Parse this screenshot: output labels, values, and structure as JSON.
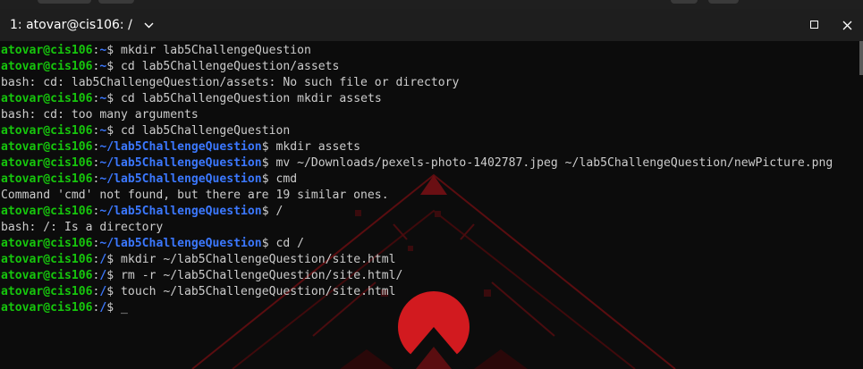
{
  "window": {
    "tab_title": "1: atovar@cis106: /",
    "icons": {
      "dropdown": "chevron-down-icon",
      "minimize": "minimize-icon",
      "maximize": "maximize-icon",
      "close": "close-icon"
    }
  },
  "colors": {
    "background": "#0c0c0c",
    "titlebar": "#1e1e1e",
    "user_host": "#16c60c",
    "path": "#3b78ff",
    "text": "#cccccc",
    "art_red": "#c0151b"
  },
  "terminal": {
    "lines": [
      {
        "user": "atovar@cis106",
        "sep": ":",
        "path": "~",
        "dollar": "$ ",
        "cmd": "mkdir lab5ChallengeQuestion"
      },
      {
        "user": "atovar@cis106",
        "sep": ":",
        "path": "~",
        "dollar": "$ ",
        "cmd": "cd lab5ChallengeQuestion/assets"
      },
      {
        "out": "bash: cd: lab5ChallengeQuestion/assets: No such file or directory"
      },
      {
        "user": "atovar@cis106",
        "sep": ":",
        "path": "~",
        "dollar": "$ ",
        "cmd": "cd lab5ChallengeQuestion mkdir assets"
      },
      {
        "out": "bash: cd: too many arguments"
      },
      {
        "user": "atovar@cis106",
        "sep": ":",
        "path": "~",
        "dollar": "$ ",
        "cmd": "cd lab5ChallengeQuestion"
      },
      {
        "user": "atovar@cis106",
        "sep": ":",
        "path": "~/lab5ChallengeQuestion",
        "dollar": "$ ",
        "cmd": "mkdir assets"
      },
      {
        "user": "atovar@cis106",
        "sep": ":",
        "path": "~/lab5ChallengeQuestion",
        "dollar": "$ ",
        "cmd": "mv ~/Downloads/pexels-photo-1402787.jpeg ~/lab5ChallengeQuestion/newPicture.png"
      },
      {
        "user": "atovar@cis106",
        "sep": ":",
        "path": "~/lab5ChallengeQuestion",
        "dollar": "$ ",
        "cmd": "cmd"
      },
      {
        "out": "Command 'cmd' not found, but there are 19 similar ones."
      },
      {
        "user": "atovar@cis106",
        "sep": ":",
        "path": "~/lab5ChallengeQuestion",
        "dollar": "$ ",
        "cmd": "/"
      },
      {
        "out": "bash: /: Is a directory"
      },
      {
        "user": "atovar@cis106",
        "sep": ":",
        "path": "~/lab5ChallengeQuestion",
        "dollar": "$ ",
        "cmd": "cd /"
      },
      {
        "user": "atovar@cis106",
        "sep": ":",
        "path": "/",
        "dollar": "$ ",
        "cmd": "mkdir ~/lab5ChallengeQuestion/site.html"
      },
      {
        "user": "atovar@cis106",
        "sep": ":",
        "path": "/",
        "dollar": "$ ",
        "cmd": "rm -r ~/lab5ChallengeQuestion/site.html/"
      },
      {
        "user": "atovar@cis106",
        "sep": ":",
        "path": "/",
        "dollar": "$ ",
        "cmd": "touch ~/lab5ChallengeQuestion/site.html"
      },
      {
        "user": "atovar@cis106",
        "sep": ":",
        "path": "/",
        "dollar": "$ ",
        "cmd": "",
        "cursor": "_"
      }
    ]
  }
}
